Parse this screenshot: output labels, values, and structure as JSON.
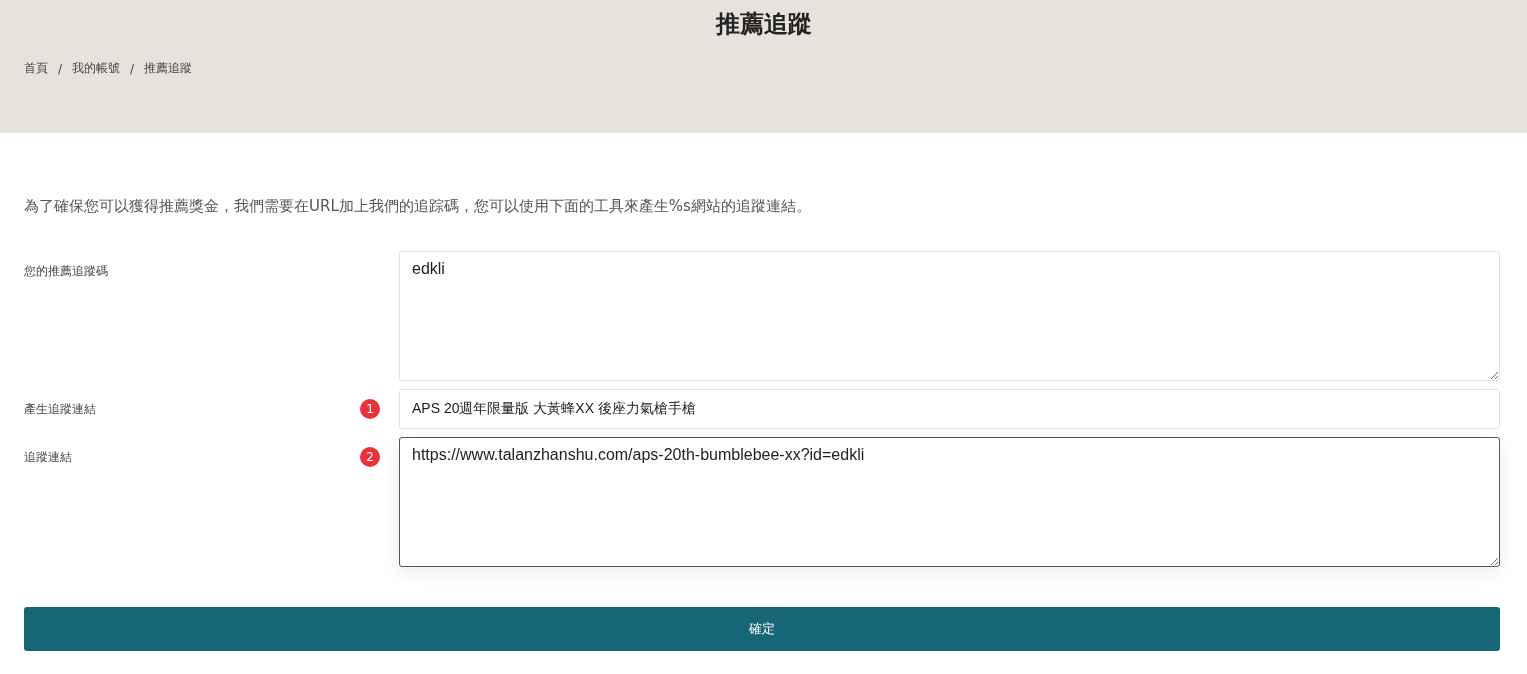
{
  "header": {
    "title": "推薦追蹤",
    "breadcrumb": [
      "首頁",
      "我的帳號",
      "推薦追蹤"
    ],
    "separator": "/"
  },
  "intro": "為了確保您可以獲得推薦獎金，我們需要在URL加上我們的追踪碼，您可以使用下面的工具來產生%s網站的追蹤連結。",
  "fields": [
    {
      "label": "您的推薦追蹤碼",
      "kind": "textarea",
      "value": "edkli",
      "focused": false
    },
    {
      "label": "產生追蹤連結",
      "kind": "input",
      "badge": "1",
      "value": "APS 20週年限量版 大黃蜂XX 後座力氣槍手槍",
      "focused": false
    },
    {
      "label": "追蹤連結",
      "kind": "textarea",
      "badge": "2",
      "value": "https://www.talanzhanshu.com/aps-20th-bumblebee-xx?id=edkli",
      "focused": true
    }
  ],
  "submit": "確定"
}
